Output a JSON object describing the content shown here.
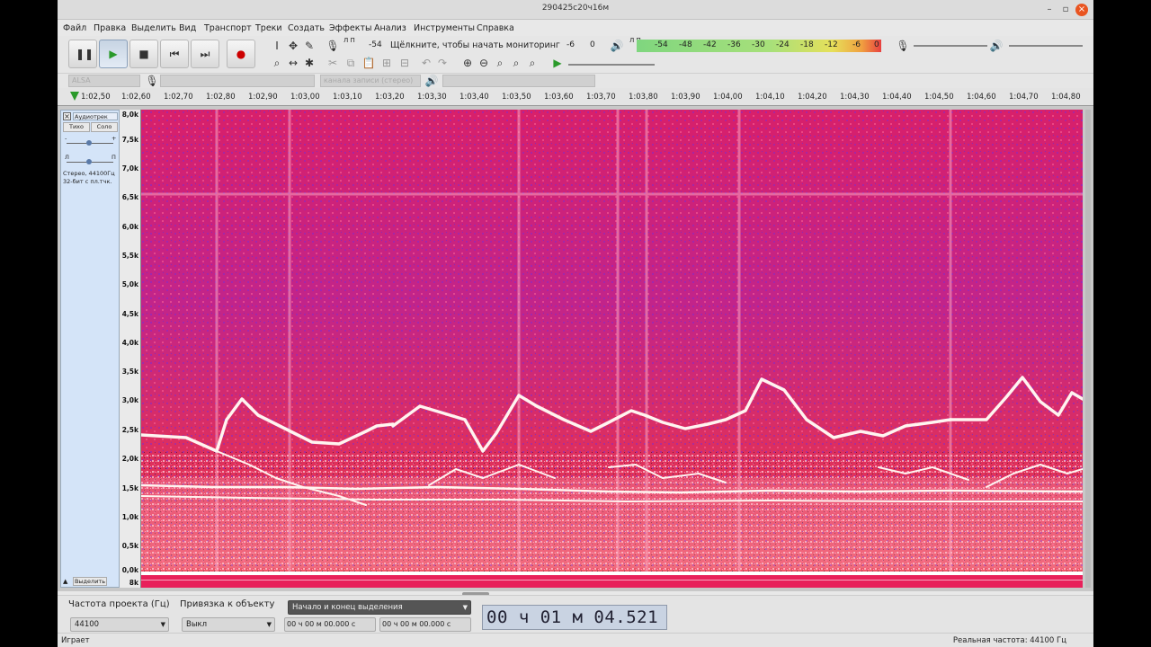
{
  "window": {
    "title": "290425с20ч16м"
  },
  "menu": [
    "Файл",
    "Правка",
    "Выделить",
    "Вид",
    "Транспорт",
    "Треки",
    "Создать",
    "Эффекты",
    "Анализ",
    "Инструменты",
    "Справка"
  ],
  "toolbar": {
    "monitor_text": "Щёлкните, чтобы начать мониторинг",
    "rec_meter_labels": [
      "-54",
      "-6",
      "0"
    ],
    "play_meter_labels": [
      "-54",
      "-48",
      "-42",
      "-36",
      "-30",
      "-24",
      "-18",
      "-12",
      "-6",
      "0"
    ],
    "rec_lr": "Л П",
    "play_lr": "Л П"
  },
  "devices": {
    "host": "ALSA",
    "channels": "канала записи (стерео)"
  },
  "ruler": [
    "1:02,50",
    "1:02,60",
    "1:02,70",
    "1:02,80",
    "1:02,90",
    "1:03,00",
    "1:03,10",
    "1:03,20",
    "1:03,30",
    "1:03,40",
    "1:03,50",
    "1:03,60",
    "1:03,70",
    "1:03,80",
    "1:03,90",
    "1:04,00",
    "1:04,10",
    "1:04,20",
    "1:04,30",
    "1:04,40",
    "1:04,50",
    "1:04,60",
    "1:04,70",
    "1:04,80"
  ],
  "track": {
    "name": "Аудиотрек",
    "mute": "Тихо",
    "solo": "Соло",
    "gain_minus": "-",
    "gain_plus": "+",
    "pan_l": "Л",
    "pan_r": "П",
    "info1": "Стерео, 44100Гц",
    "info2": "32-бит с пл.тчк.",
    "select": "Выделить",
    "yticks": [
      "8,0k",
      "7,5k",
      "7,0k",
      "6,5k",
      "6,0k",
      "5,5k",
      "5,0k",
      "4,5k",
      "4,0k",
      "3,5k",
      "3,0k",
      "2,5k",
      "2,0k",
      "1,5k",
      "1,0k",
      "0,5k",
      "0,0k"
    ],
    "yticks_low": "8k"
  },
  "bottom": {
    "rate_label": "Частота проекта (Гц)",
    "rate_value": "44100",
    "snap_label": "Привязка к объекту",
    "snap_value": "Выкл",
    "sel_mode": "Начало и конец выделения",
    "sel_start": "00 ч 00 м 00.000 с",
    "sel_end": "00 ч 00 м 00.000 с",
    "time": "00 ч 01 м 04.521 с"
  },
  "status": {
    "left": "Играет",
    "right": "Реальная частота: 44100 Гц"
  },
  "colors": {
    "spec_base": "#e0205a",
    "spec_purple": "#8a2bd8",
    "spec_white": "#ffffff"
  }
}
